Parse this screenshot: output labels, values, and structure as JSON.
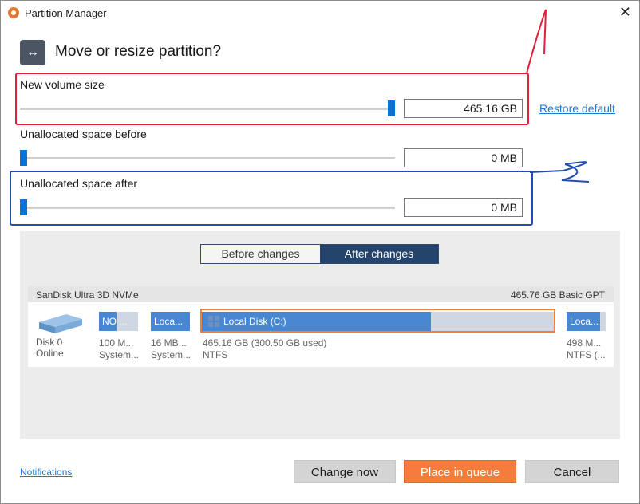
{
  "window": {
    "title": "Partition Manager",
    "close_glyph": "✕"
  },
  "header": {
    "icon": "move-resize-icon",
    "icon_glyph": "↔",
    "title": "Move or resize partition?"
  },
  "fields": {
    "new_volume_size": {
      "label": "New volume size",
      "value": "465.16 GB",
      "slider_fraction": 1.0
    },
    "unallocated_before": {
      "label": "Unallocated space before",
      "value": "0 MB",
      "slider_fraction": 0.0
    },
    "unallocated_after": {
      "label": "Unallocated space after",
      "value": "0 MB",
      "slider_fraction": 0.0
    },
    "restore_default": "Restore default"
  },
  "annotations": {
    "mark_1": "1",
    "mark_2": "2",
    "mark_1_color": "#e0203a",
    "mark_2_color": "#1f4fae"
  },
  "tabs": {
    "before": "Before changes",
    "after": "After changes",
    "active": "after"
  },
  "disk": {
    "name": "SanDisk Ultra 3D NVMe",
    "info": "465.76 GB Basic GPT",
    "label": "Disk 0",
    "status": "Online",
    "partitions": [
      {
        "title": "NO ...",
        "size": "100 M...",
        "fs": "System...",
        "used_fraction": 0.45
      },
      {
        "title": "Loca...",
        "size": "16 MB...",
        "fs": "System...",
        "used_fraction": 1.0
      },
      {
        "title": "Local Disk (C:)",
        "size": "465.16 GB (300.50 GB used)",
        "fs": "NTFS",
        "used_fraction": 0.65,
        "selected": true
      },
      {
        "title": "Loca...",
        "size": "498 M...",
        "fs": "NTFS (...",
        "used_fraction": 0.85
      }
    ]
  },
  "footer": {
    "notifications": "Notifications",
    "change_now": "Change now",
    "place_in_queue": "Place in queue",
    "cancel": "Cancel"
  },
  "colors": {
    "accent": "#0b72d6",
    "primary_button": "#f57c3a",
    "tab_active": "#24446b",
    "partition_fill": "#4a87d1"
  }
}
